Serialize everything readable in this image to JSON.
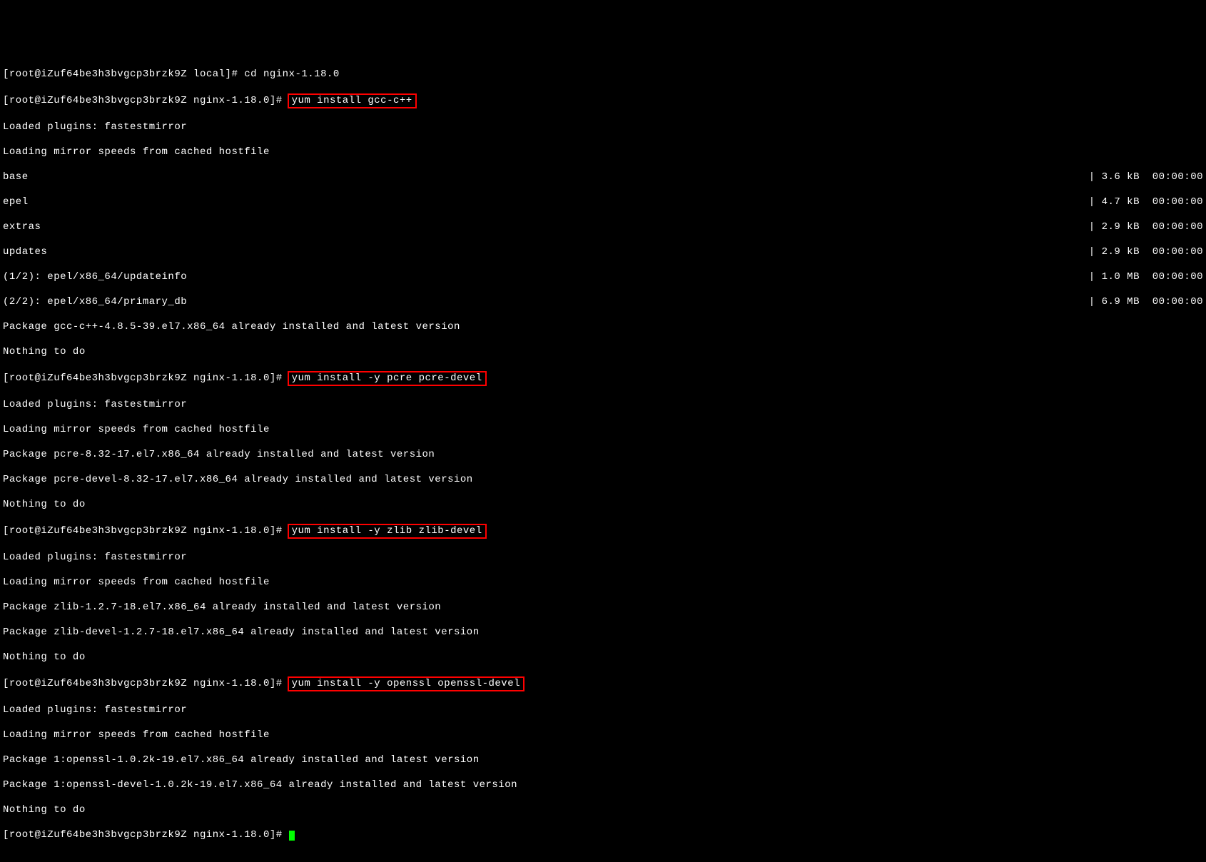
{
  "prompt": "[root@iZuf64be3h3bvgcp3brzk9Z nginx-1.18.0]# ",
  "prompt_local": "[root@iZuf64be3h3bvgcp3brzk9Z local]# ",
  "commands": {
    "cd": "cd nginx-1.18.0",
    "yum_gcc": "yum install gcc-c++",
    "yum_pcre": "yum install -y pcre pcre-devel",
    "yum_zlib": "yum install -y zlib zlib-devel",
    "yum_openssl": "yum install -y openssl openssl-devel"
  },
  "output": {
    "loaded_plugins": "Loaded plugins: fastestmirror",
    "loading_mirror": "Loading mirror speeds from cached hostfile",
    "nothing_to_do": "Nothing to do",
    "pkg_gcc": "Package gcc-c++-4.8.5-39.el7.x86_64 already installed and latest version",
    "pkg_pcre": "Package pcre-8.32-17.el7.x86_64 already installed and latest version",
    "pkg_pcre_devel": "Package pcre-devel-8.32-17.el7.x86_64 already installed and latest version",
    "pkg_zlib": "Package zlib-1.2.7-18.el7.x86_64 already installed and latest version",
    "pkg_zlib_devel": "Package zlib-devel-1.2.7-18.el7.x86_64 already installed and latest version",
    "pkg_openssl": "Package 1:openssl-1.0.2k-19.el7.x86_64 already installed and latest version",
    "pkg_openssl_devel": "Package 1:openssl-devel-1.0.2k-19.el7.x86_64 already installed and latest version",
    "epel_update": "(1/2): epel/x86_64/updateinfo",
    "epel_primary": "(2/2): epel/x86_64/primary_db"
  },
  "repos": {
    "base": {
      "name": "base",
      "size": "| 3.6 kB  00:00:00"
    },
    "epel": {
      "name": "epel",
      "size": "| 4.7 kB  00:00:00"
    },
    "extras": {
      "name": "extras",
      "size": "| 2.9 kB  00:00:00"
    },
    "updates": {
      "name": "updates",
      "size": "| 2.9 kB  00:00:00"
    },
    "epel_update": {
      "size": "| 1.0 MB  00:00:00"
    },
    "epel_primary": {
      "size": "| 6.9 MB  00:00:00"
    }
  }
}
